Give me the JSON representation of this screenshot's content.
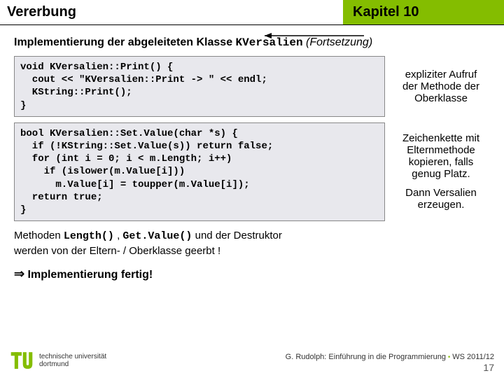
{
  "header": {
    "left": "Vererbung",
    "right": "Kapitel 10"
  },
  "subtitle": {
    "text": "Implementierung der abgeleiteten Klasse ",
    "classname": "KVersalien",
    "cont": " (Fortsetzung)"
  },
  "block1": {
    "code": "void KVersalien::Print() {\n  cout << \"KVersalien::Print -> \" << endl;\n  KString::Print();\n}",
    "annot1": "expliziter Aufruf der Methode der Oberklasse"
  },
  "block2": {
    "code": "bool KVersalien::Set.Value(char *s) {\n  if (!KString::Set.Value(s)) return false;\n  for (int i = 0; i < m.Length; i++)\n    if (islower(m.Value[i]))\n      m.Value[i] = toupper(m.Value[i]);\n  return true;\n}",
    "annot1": "Zeichenkette mit Elternmethode kopieren, falls genug Platz.",
    "annot2": "Dann Versalien erzeugen."
  },
  "methods": {
    "p1a": "Methoden ",
    "m1": "Length()",
    "sep": " , ",
    "m2": "Get.Value()",
    "p1b": " und der Destruktor",
    "p2": "werden von der Eltern- / Oberklasse geerbt !"
  },
  "impl": {
    "arrow": "⇒",
    "text": " Implementierung fertig!"
  },
  "footer": {
    "line": "G. Rudolph: Einführung in die Programmierung ",
    "sem": " WS 2011/12",
    "page": "17"
  },
  "logo": {
    "line1": "technische universität",
    "line2": "dortmund"
  }
}
